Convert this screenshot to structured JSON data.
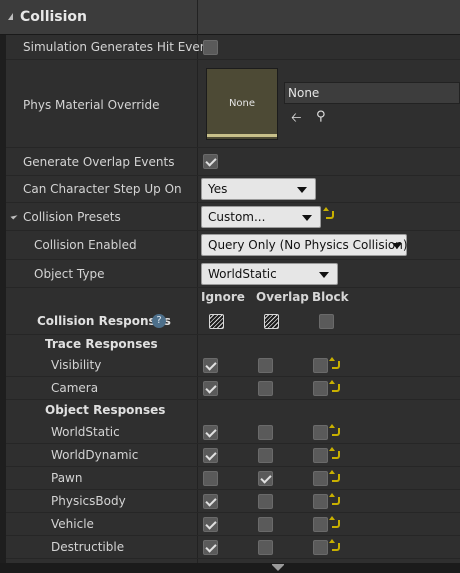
{
  "section": {
    "title": "Collision"
  },
  "properties": {
    "sim_hit": {
      "label": "Simulation Generates Hit Events",
      "checked": false
    },
    "phys_material": {
      "label": "Phys Material Override",
      "thumb_text": "None",
      "name": "None",
      "back_icon": "arrow-left-icon",
      "find_icon": "magnifier-icon"
    },
    "overlap_events": {
      "label": "Generate Overlap Events",
      "checked": true
    },
    "step_up": {
      "label": "Can Character Step Up On",
      "value": "Yes"
    },
    "presets": {
      "label": "Collision Presets",
      "value": "Custom..."
    },
    "enabled": {
      "label": "Collision Enabled",
      "value": "Query Only (No Physics Collision)"
    },
    "object_type": {
      "label": "Object Type",
      "value": "WorldStatic"
    }
  },
  "columns": {
    "ignore": "Ignore",
    "overlap": "Overlap",
    "block": "Block"
  },
  "responses": {
    "label": "Collision Responses",
    "help_glyph": "?",
    "trace_header": "Trace Responses",
    "object_header": "Object Responses",
    "trace": [
      {
        "name": "Visibility",
        "state": "ignore"
      },
      {
        "name": "Camera",
        "state": "ignore"
      }
    ],
    "object": [
      {
        "name": "WorldStatic",
        "state": "ignore"
      },
      {
        "name": "WorldDynamic",
        "state": "ignore"
      },
      {
        "name": "Pawn",
        "state": "overlap"
      },
      {
        "name": "PhysicsBody",
        "state": "ignore"
      },
      {
        "name": "Vehicle",
        "state": "ignore"
      },
      {
        "name": "Destructible",
        "state": "ignore"
      }
    ]
  },
  "colors": {
    "accent_reset": "#c8b000",
    "panel_bg": "#2f2f2f",
    "header_bg": "#3c3c3c"
  }
}
